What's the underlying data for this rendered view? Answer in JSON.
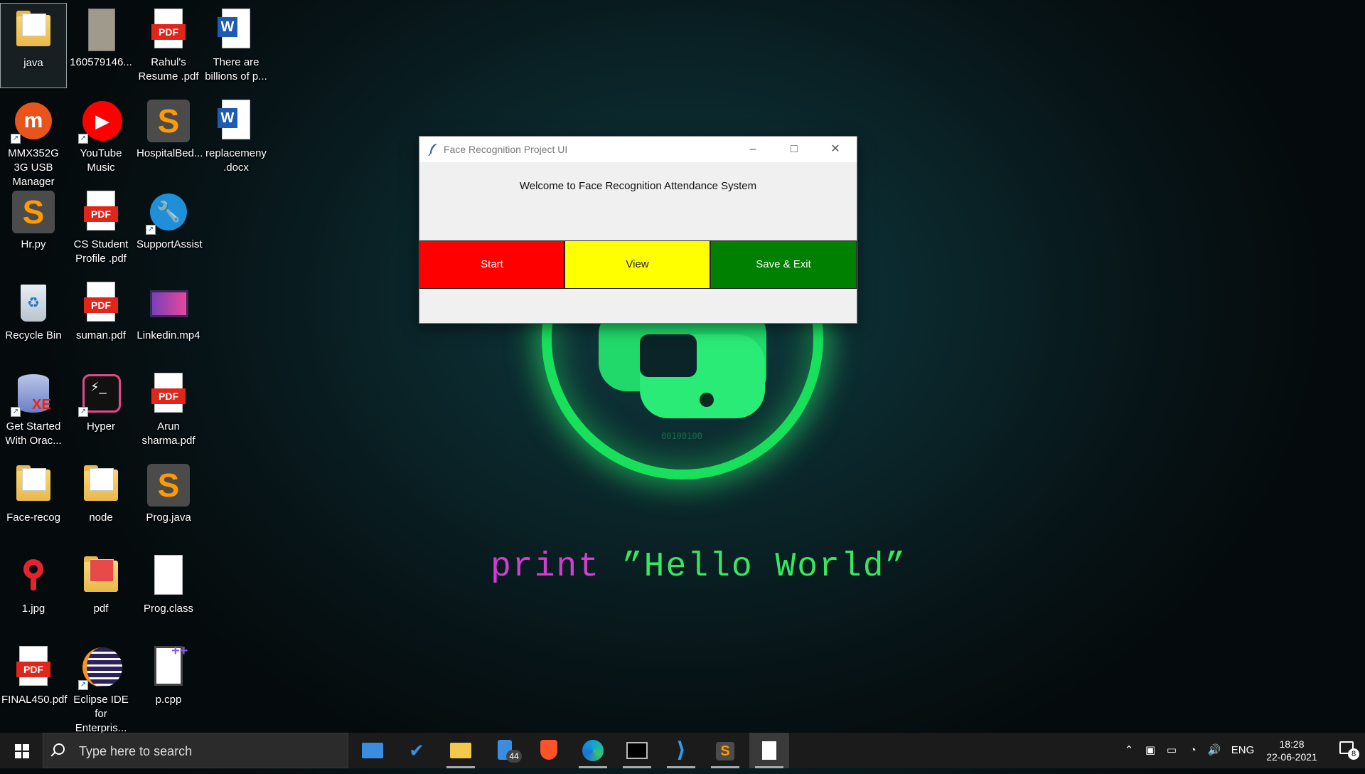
{
  "desktop": {
    "icons": [
      {
        "label": "java",
        "kind": "folder"
      },
      {
        "label": "160579146...",
        "kind": "image"
      },
      {
        "label": "Rahul's Resume .pdf",
        "kind": "pdf"
      },
      {
        "label": "There are billions of p...",
        "kind": "word"
      },
      {
        "label": "MMX352G 3G USB Manager",
        "kind": "app"
      },
      {
        "label": "YouTube Music",
        "kind": "app"
      },
      {
        "label": "HospitalBed...",
        "kind": "sublime"
      },
      {
        "label": "replacemeny .docx",
        "kind": "word"
      },
      {
        "label": "Hr.py",
        "kind": "sublime"
      },
      {
        "label": "CS Student Profile .pdf",
        "kind": "pdf"
      },
      {
        "label": "SupportAssist",
        "kind": "app"
      },
      {
        "label": "Recycle Bin",
        "kind": "recycle"
      },
      {
        "label": "suman.pdf",
        "kind": "pdf"
      },
      {
        "label": "Linkedin.mp4",
        "kind": "video"
      },
      {
        "label": "Get Started With Orac...",
        "kind": "app"
      },
      {
        "label": "Hyper",
        "kind": "app"
      },
      {
        "label": "Arun sharma.pdf",
        "kind": "pdf"
      },
      {
        "label": "Face-recog",
        "kind": "folder"
      },
      {
        "label": "node",
        "kind": "folder"
      },
      {
        "label": "Prog.java",
        "kind": "sublime"
      },
      {
        "label": "1.jpg",
        "kind": "image"
      },
      {
        "label": "pdf",
        "kind": "folder"
      },
      {
        "label": "Prog.class",
        "kind": "file"
      },
      {
        "label": "FINAL450.pdf",
        "kind": "pdf"
      },
      {
        "label": "Eclipse IDE for Enterpris...",
        "kind": "app"
      },
      {
        "label": "p.cpp",
        "kind": "file"
      }
    ]
  },
  "wallpaper": {
    "binary_text": "00100100",
    "code_keyword": "print",
    "code_string": "”Hello World”"
  },
  "window": {
    "title": "Face Recognition Project UI",
    "minimize_glyph": "–",
    "maximize_glyph": "□",
    "close_glyph": "✕",
    "welcome": "Welcome to Face Recognition Attendance System",
    "buttons": {
      "start": "Start",
      "view": "View",
      "save_exit": "Save & Exit"
    },
    "colors": {
      "start": "#ff0000",
      "view": "#ffff00",
      "save_exit": "#008000"
    }
  },
  "taskbar": {
    "search_placeholder": "Type here to search",
    "mail_badge": "44",
    "language": "ENG",
    "time": "18:28",
    "date": "22-06-2021",
    "notification_count": "8"
  }
}
